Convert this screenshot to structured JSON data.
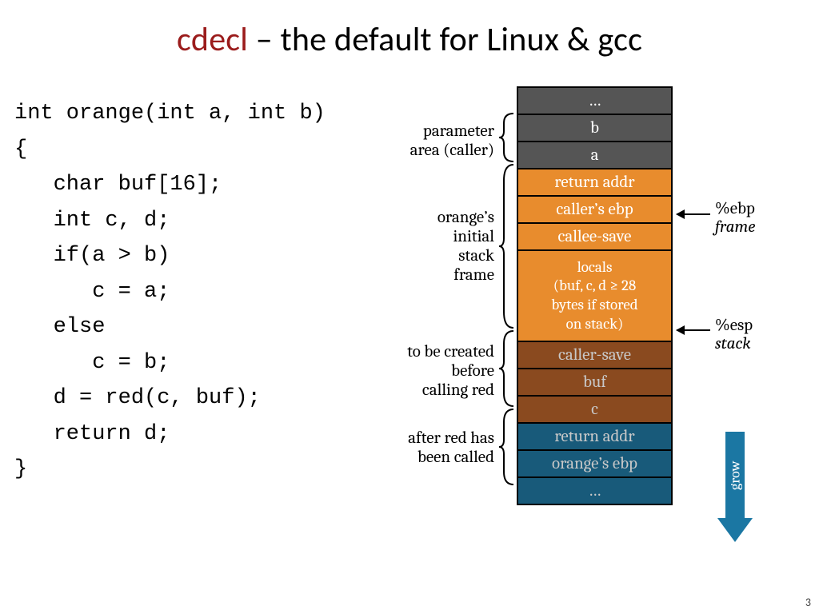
{
  "title": {
    "highlight": "cdecl",
    "rest": " – the default for Linux & gcc"
  },
  "code": "int orange(int a, int b)\n{\n   char buf[16];\n   int c, d;\n   if(a > b)\n      c = a;\n   else\n      c = b;\n   d = red(c, buf);\n   return d;\n}",
  "labels": {
    "param": "parameter\narea (caller)",
    "oframe": "orange’s\ninitial\nstack\nframe",
    "tocreate": "to be created\nbefore\ncalling red",
    "afterred": "after red has\nbeen called",
    "ebp": "%ebp",
    "ebp_sub": "frame",
    "esp": "%esp",
    "esp_sub": "stack",
    "grow": "grow"
  },
  "cells": {
    "dots1": "…",
    "b": "b",
    "a": "a",
    "ret1": "return addr",
    "cebp": "caller’s ebp",
    "csave": "callee-save",
    "locals": "locals\n(buf, c, d ≥ 28\nbytes if stored\non stack)",
    "callersave": "caller-save",
    "buf": "buf",
    "c": "c",
    "ret2": "return addr",
    "oebp": "orange’s ebp",
    "dots2": "…"
  },
  "pagenum": "3"
}
